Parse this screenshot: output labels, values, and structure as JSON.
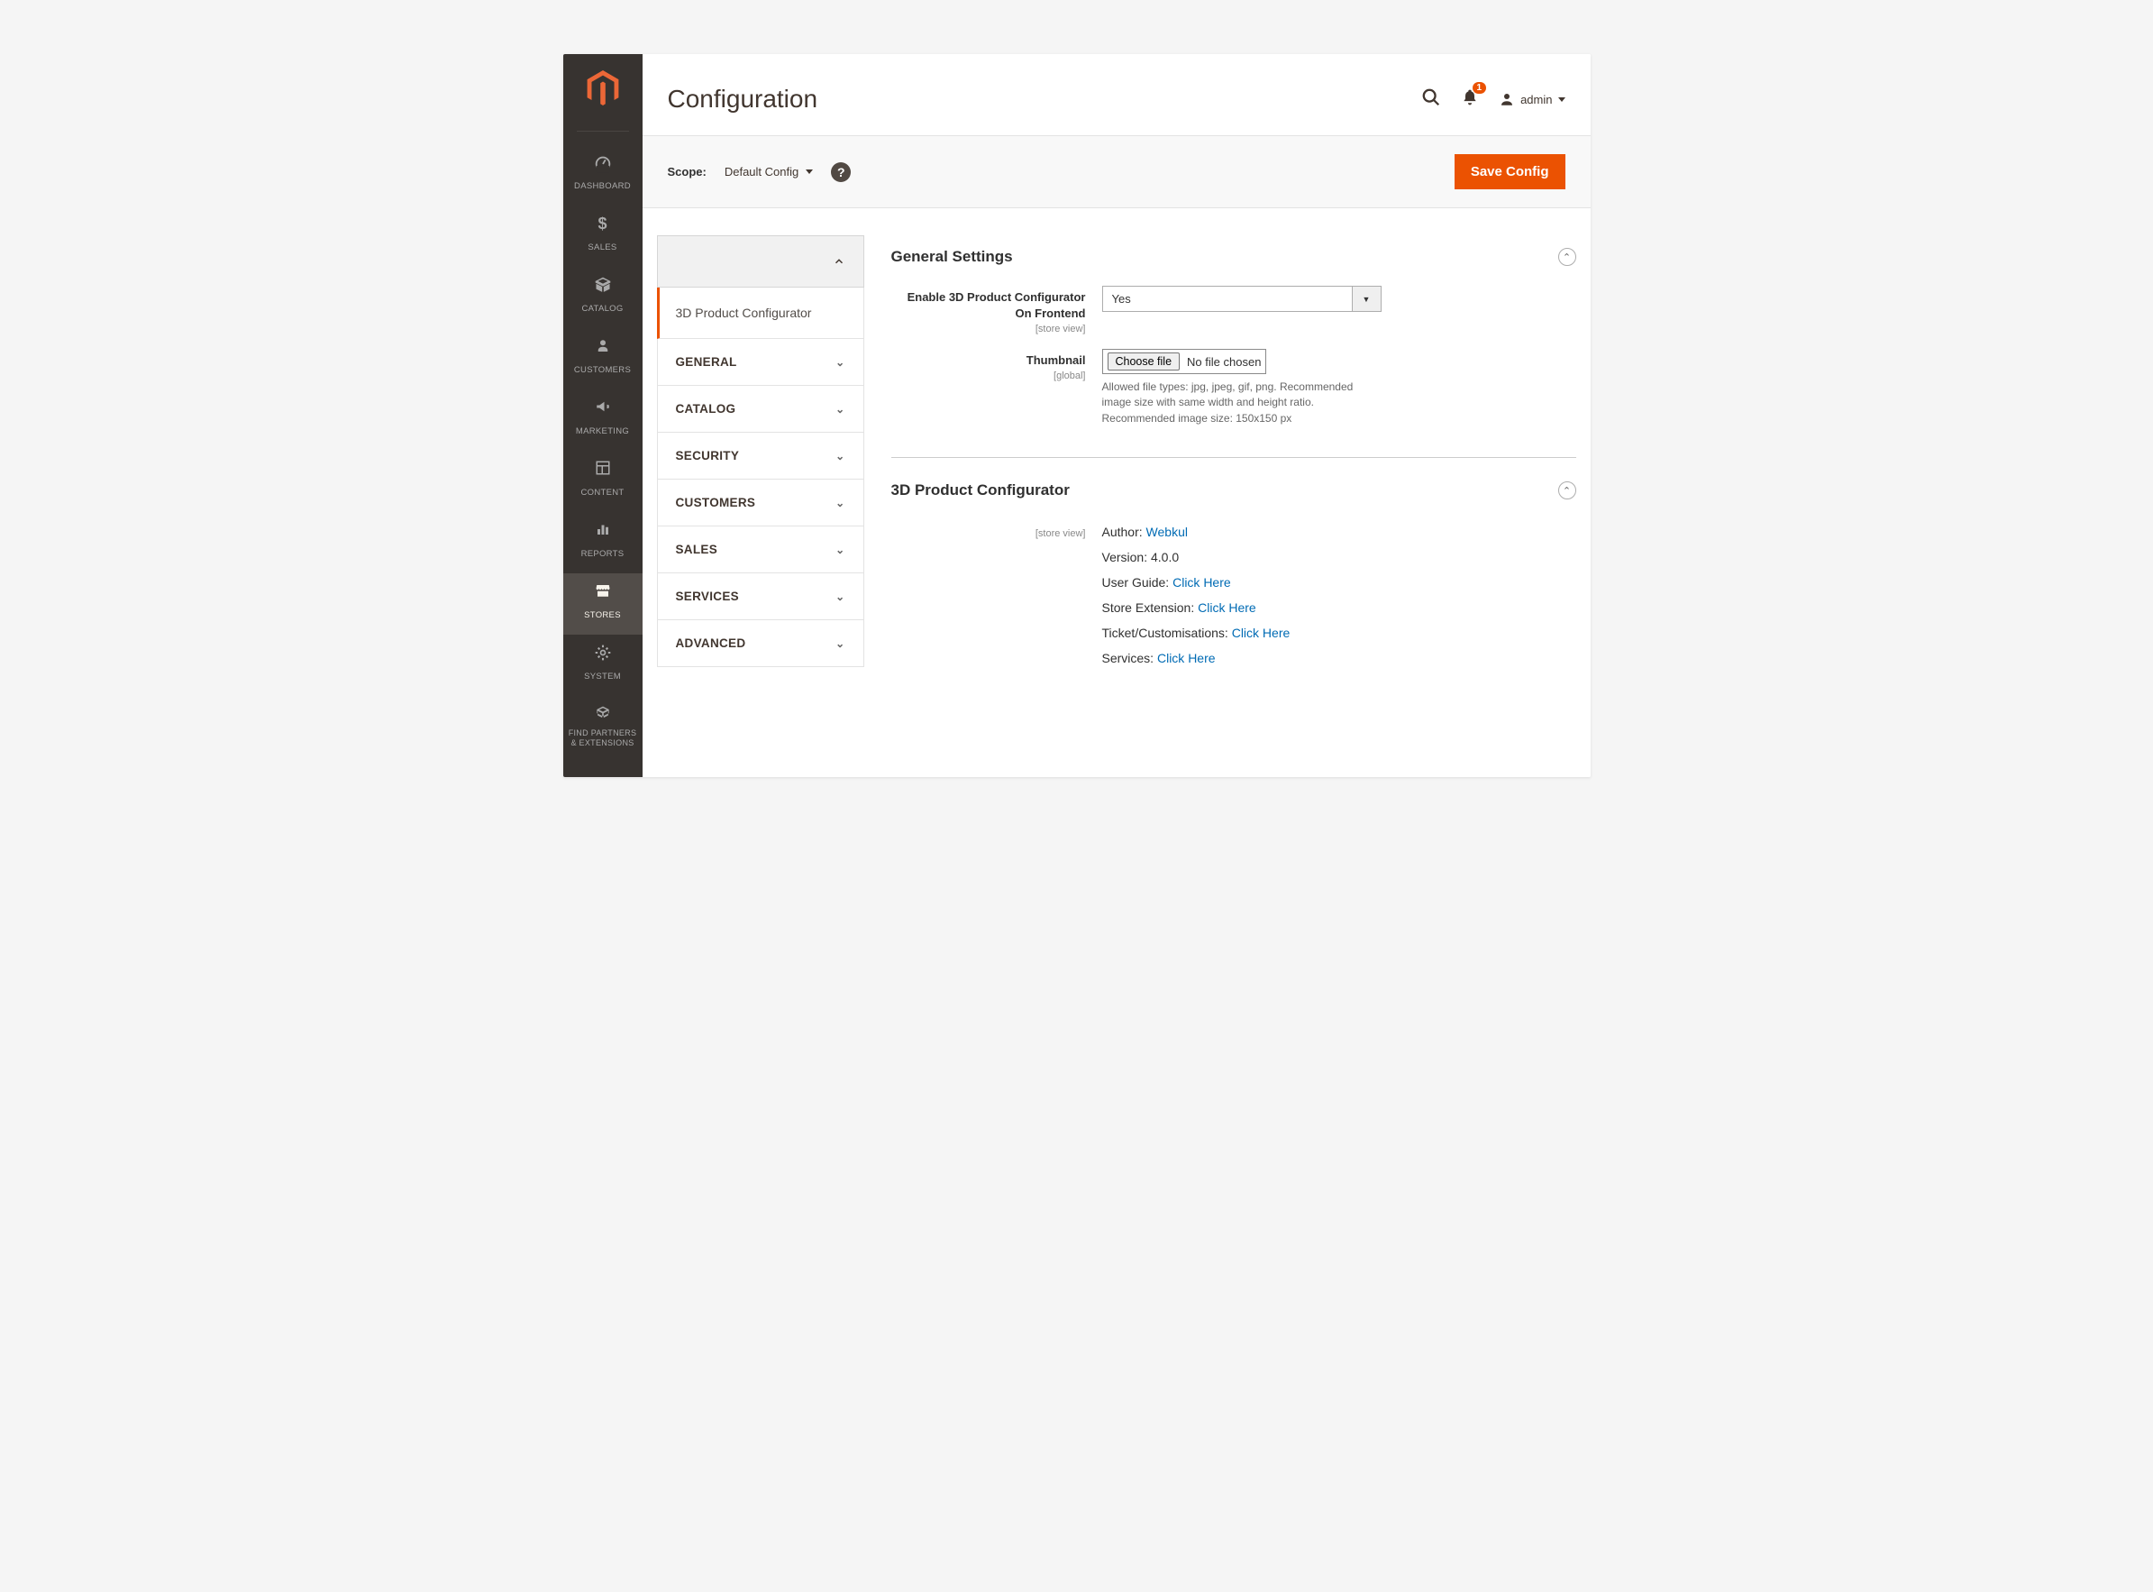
{
  "sidebar": {
    "items": [
      {
        "label": "DASHBOARD"
      },
      {
        "label": "SALES"
      },
      {
        "label": "CATALOG"
      },
      {
        "label": "CUSTOMERS"
      },
      {
        "label": "MARKETING"
      },
      {
        "label": "CONTENT"
      },
      {
        "label": "REPORTS"
      },
      {
        "label": "STORES"
      },
      {
        "label": "SYSTEM"
      },
      {
        "label": "FIND PARTNERS & EXTENSIONS"
      }
    ]
  },
  "header": {
    "title": "Configuration",
    "notifications": "1",
    "user": "admin"
  },
  "scope": {
    "label": "Scope:",
    "value": "Default Config",
    "save": "Save Config"
  },
  "config_nav": {
    "active": "3D Product Configurator",
    "sections": [
      "GENERAL",
      "CATALOG",
      "SECURITY",
      "CUSTOMERS",
      "SALES",
      "SERVICES",
      "ADVANCED"
    ]
  },
  "general_settings": {
    "title": "General Settings",
    "enable": {
      "label": "Enable 3D Product Configurator On Frontend",
      "scope": "[store view]",
      "value": "Yes"
    },
    "thumbnail": {
      "label": "Thumbnail",
      "scope": "[global]",
      "button": "Choose file",
      "status": "No file chosen",
      "hint": "Allowed file types: jpg, jpeg, gif, png. Recommended image size with same width and height ratio. Recommended image size: 150x150 px"
    }
  },
  "product_config": {
    "title": "3D Product Configurator",
    "scope": "[store view]",
    "author_label": "Author: ",
    "author_link": "Webkul",
    "version_label": "Version: ",
    "version": "4.0.0",
    "guide_label": "User Guide: ",
    "guide_link": "Click Here",
    "ext_label": "Store Extension: ",
    "ext_link": "Click Here",
    "ticket_label": "Ticket/Customisations: ",
    "ticket_link": "Click Here",
    "services_label": "Services: ",
    "services_link": "Click Here"
  }
}
